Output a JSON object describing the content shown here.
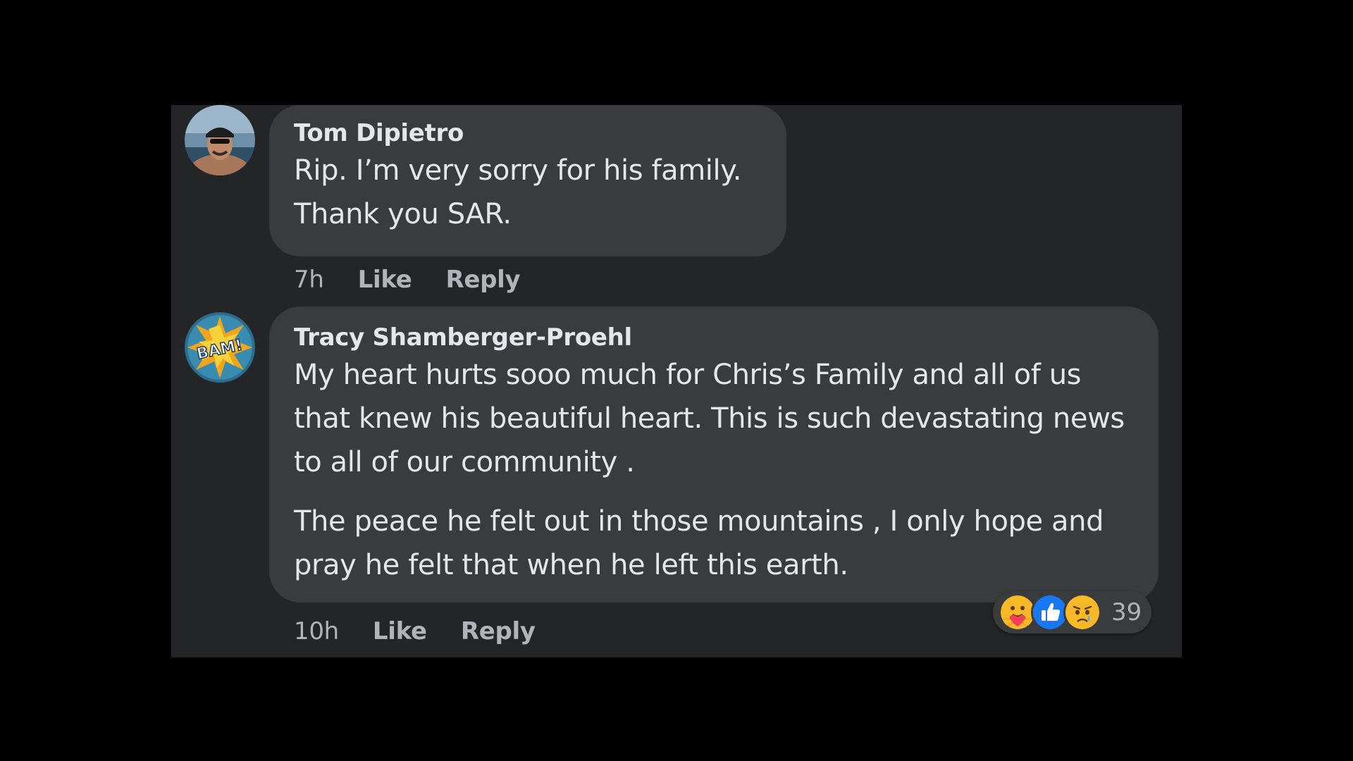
{
  "comments": [
    {
      "author": "Tom Dipietro",
      "paragraphs": [
        "Rip. I’m very sorry for his family.\nThank you SAR."
      ],
      "line1": "Rip. I’m very sorry for his family.",
      "line2": "Thank you SAR.",
      "time": "7h",
      "like_label": "Like",
      "reply_label": "Reply",
      "avatar_icon": "profile-photo"
    },
    {
      "author": "Tracy Shamberger-Proehl",
      "p1": "My heart hurts sooo much for Chris’s Family and all of us that knew his beautiful heart. This is such devastating news to all of our community .",
      "p2": "The peace he felt out in those mountains , I only hope and pray he felt that when he left this earth.",
      "time": "10h",
      "like_label": "Like",
      "reply_label": "Reply",
      "avatar_icon": "bam-comic-avatar",
      "avatar_text": "BAM!",
      "reactions": {
        "icons": [
          "care-icon",
          "like-icon",
          "sad-icon"
        ],
        "count": "39"
      }
    }
  ],
  "colors": {
    "background": "#000000",
    "panel": "#242526",
    "bubble": "#3a3b3c",
    "text_primary": "#e4e6eb",
    "text_secondary": "#b0b3b8",
    "like_blue": "#1877f2",
    "reaction_yellow": "#f7b928"
  }
}
